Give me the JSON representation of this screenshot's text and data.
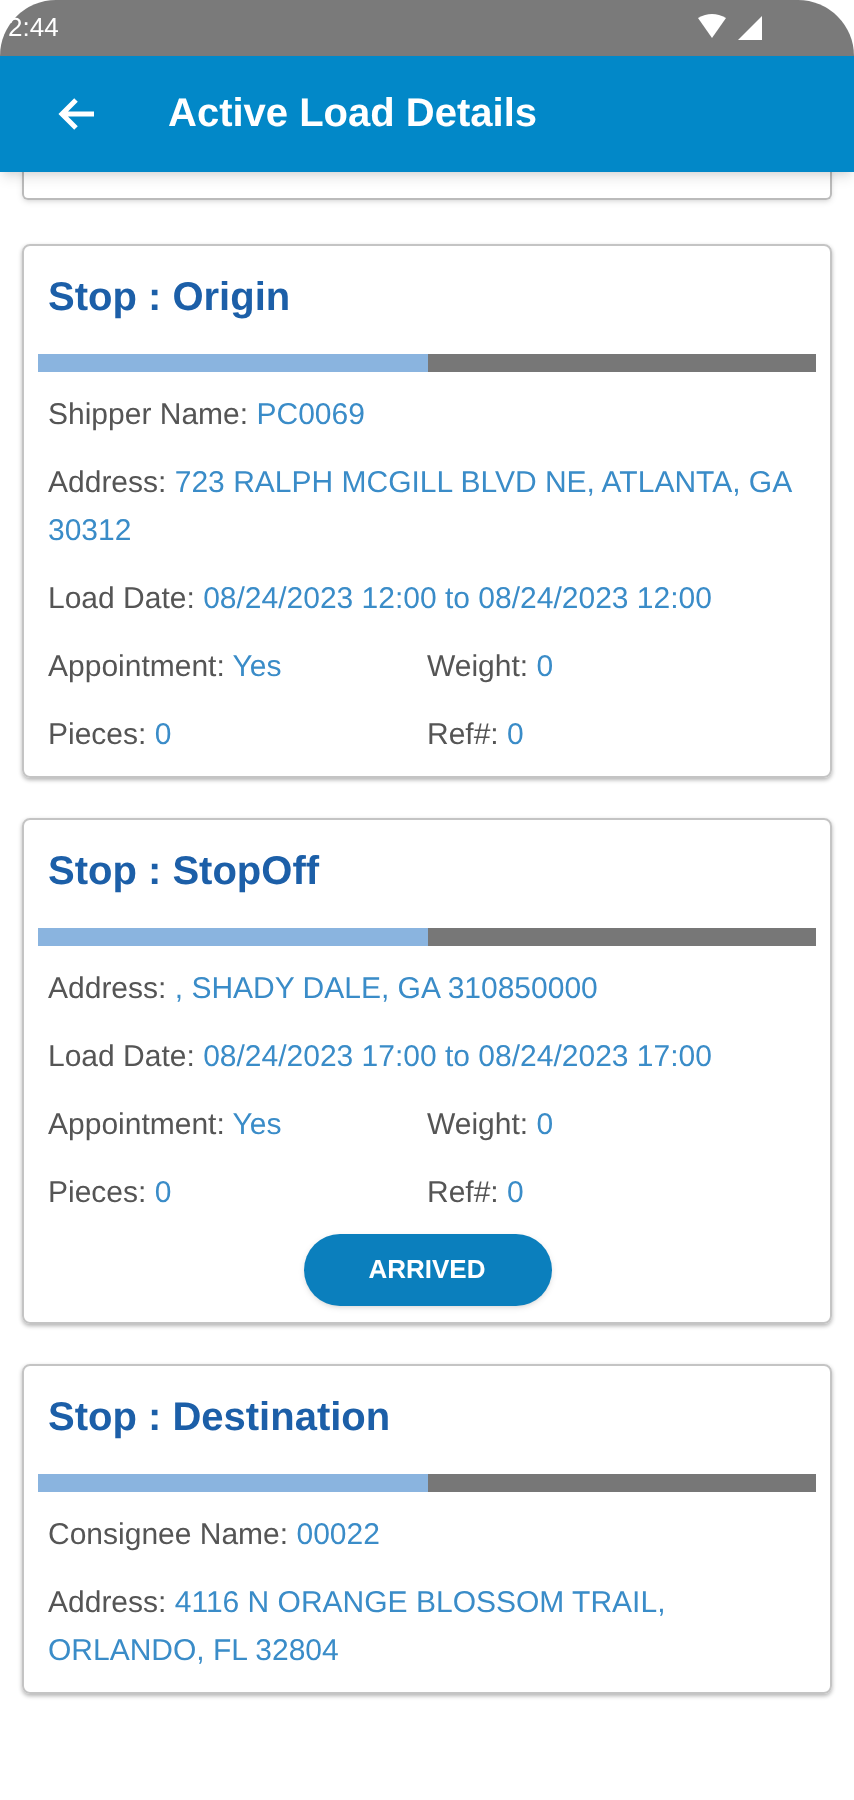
{
  "status_bar": {
    "time": "2:44"
  },
  "app_bar": {
    "title": "Active Load Details"
  },
  "stops": [
    {
      "title": "Stop : Origin",
      "level": 0.5,
      "rows": [
        [
          {
            "label": "Shipper Name:",
            "value": "PC0069"
          }
        ],
        [
          {
            "label": "Address:",
            "value": "723 RALPH MCGILL BLVD NE, ATLANTA, GA 30312"
          }
        ],
        [
          {
            "label": "Load Date:",
            "value": "08/24/2023 12:00 to 08/24/2023 12:00"
          }
        ],
        [
          {
            "label": "Appointment:",
            "value": "Yes"
          },
          {
            "label": "Weight:",
            "value": "0"
          }
        ],
        [
          {
            "label": "Pieces:",
            "value": "0"
          },
          {
            "label": "Ref#:",
            "value": "0"
          }
        ]
      ]
    },
    {
      "title": "Stop : StopOff",
      "level": 0.5,
      "rows": [
        [
          {
            "label": "Address:",
            "value": ", SHADY DALE, GA 310850000"
          }
        ],
        [
          {
            "label": "Load Date:",
            "value": "08/24/2023 17:00 to 08/24/2023 17:00"
          }
        ],
        [
          {
            "label": "Appointment:",
            "value": "Yes"
          },
          {
            "label": "Weight:",
            "value": "0"
          }
        ],
        [
          {
            "label": "Pieces:",
            "value": "0"
          },
          {
            "label": "Ref#:",
            "value": "0"
          }
        ]
      ],
      "button": "ARRIVED"
    },
    {
      "title": "Stop : Destination",
      "level": 0.5,
      "rows": [
        [
          {
            "label": "Consignee Name:",
            "value": "00022"
          }
        ],
        [
          {
            "label": "Address:",
            "value": "4116 N ORANGE BLOSSOM TRAIL, ORLANDO, FL 32804"
          }
        ]
      ]
    }
  ]
}
